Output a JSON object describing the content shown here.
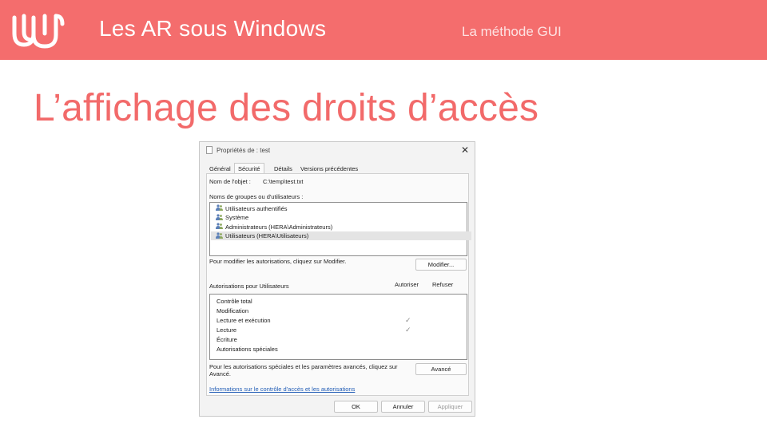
{
  "header": {
    "title": "Les AR sous Windows",
    "subtitle": "La méthode GUI"
  },
  "slide": {
    "title": "L’affichage des droits d’accès"
  },
  "dialog": {
    "window_title": "Propriétés de : test",
    "tabs": [
      {
        "label": "Général",
        "active": false
      },
      {
        "label": "Sécurité",
        "active": true
      },
      {
        "label": "Détails",
        "active": false
      },
      {
        "label": "Versions précédentes",
        "active": false
      }
    ],
    "object_name_label": "Nom de l'objet :",
    "object_name_value": "C:\\temp\\test.txt",
    "groups_label": "Noms de groupes ou d'utilisateurs :",
    "groups": [
      {
        "label": "Utilisateurs authentifiés",
        "icon": "users-icon",
        "selected": false
      },
      {
        "label": "Système",
        "icon": "users-icon",
        "selected": false
      },
      {
        "label": "Administrateurs (HERA\\Administrateurs)",
        "icon": "users-icon",
        "selected": false
      },
      {
        "label": "Utilisateurs (HERA\\Utilisateurs)",
        "icon": "users-icon",
        "selected": true
      }
    ],
    "modify_hint": "Pour modifier les autorisations, cliquez sur Modifier.",
    "modify_button": "Modifier...",
    "permissions_label": "Autorisations pour Utilisateurs",
    "allow_header": "Autoriser",
    "deny_header": "Refuser",
    "permissions": [
      {
        "label": "Contrôle total",
        "allow": false,
        "deny": false
      },
      {
        "label": "Modification",
        "allow": false,
        "deny": false
      },
      {
        "label": "Lecture et exécution",
        "allow": true,
        "deny": false
      },
      {
        "label": "Lecture",
        "allow": true,
        "deny": false
      },
      {
        "label": "Écriture",
        "allow": false,
        "deny": false
      },
      {
        "label": "Autorisations spéciales",
        "allow": false,
        "deny": false
      }
    ],
    "check_glyph": "✓",
    "advanced_hint_line1": "Pour les autorisations spéciales et les paramètres avancés, cliquez sur",
    "advanced_hint_line2": "Avancé.",
    "advanced_button": "Avancé",
    "info_link": "Informations sur le contrôle d'accès et les autorisations",
    "ok_button": "OK",
    "cancel_button": "Annuler",
    "apply_button": "Appliquer"
  },
  "colors": {
    "header_bg": "#f46d6d",
    "title_color": "#f26a6a",
    "link_color": "#1f5bb5"
  }
}
